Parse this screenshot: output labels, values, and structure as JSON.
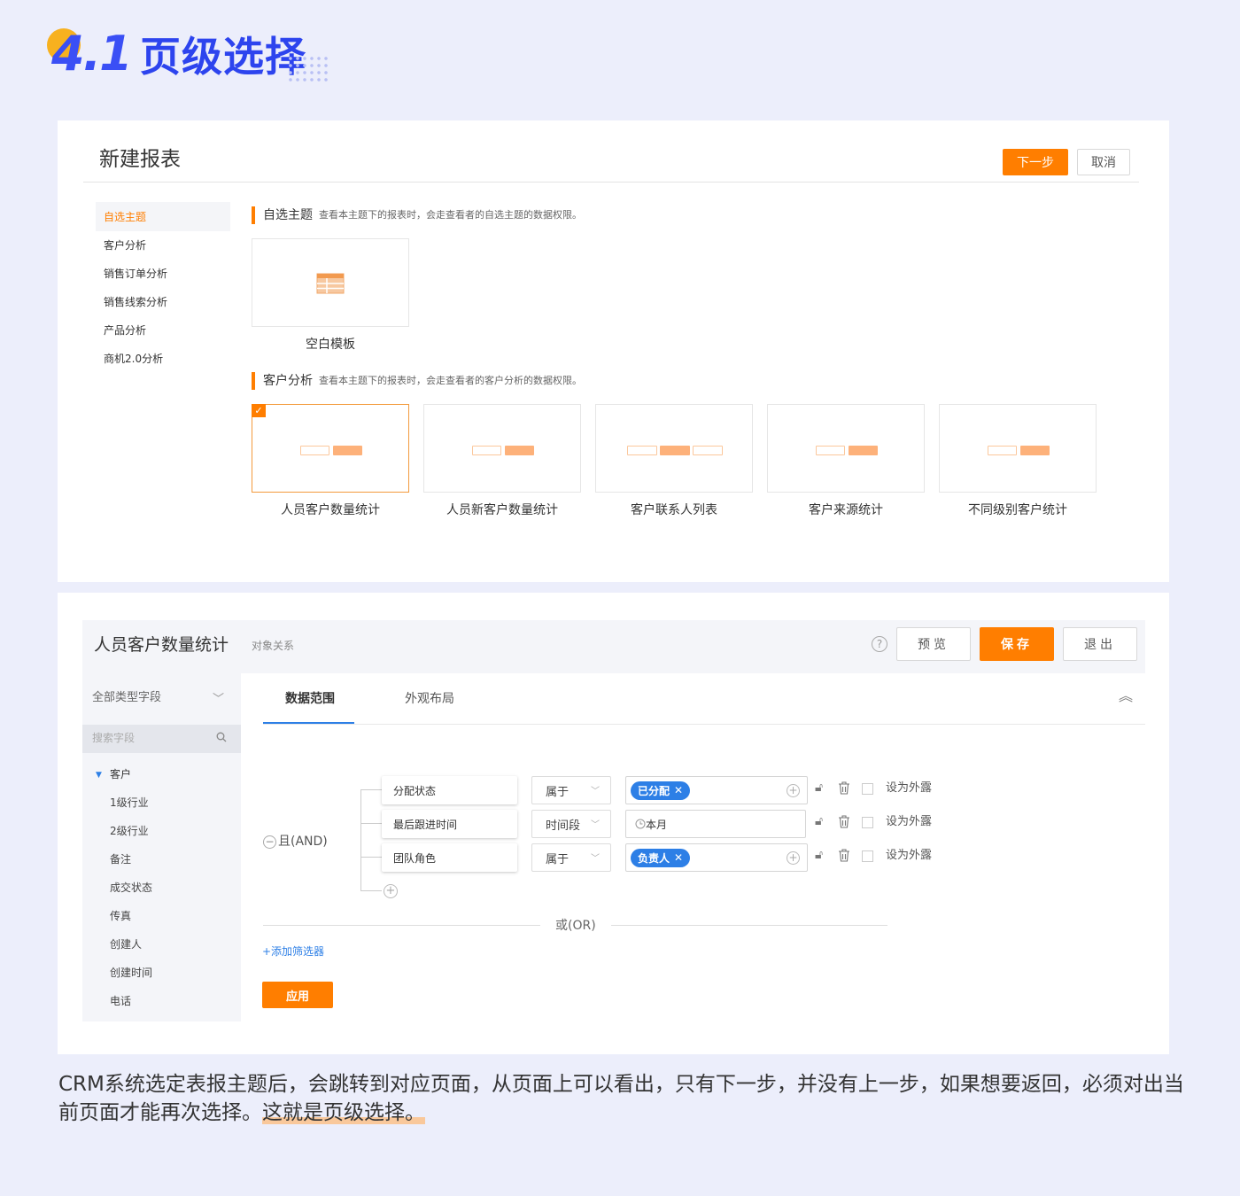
{
  "heading": {
    "number": "4.1",
    "title": "页级选择"
  },
  "panel1": {
    "title": "新建报表",
    "next_button": "下一步",
    "cancel_button": "取消",
    "sidebar": [
      "自选主题",
      "客户分析",
      "销售订单分析",
      "销售线索分析",
      "产品分析",
      "商机2.0分析"
    ],
    "sections": [
      {
        "title": "自选主题",
        "desc": "查看本主题下的报表时，会走查看者的自选主题的数据权限。",
        "cards": [
          "空白模板"
        ]
      },
      {
        "title": "客户分析",
        "desc": "查看本主题下的报表时，会走查看者的客户分析的数据权限。",
        "cards": [
          "人员客户数量统计",
          "人员新客户数量统计",
          "客户联系人列表",
          "客户来源统计",
          "不同级别客户统计"
        ]
      }
    ],
    "selected_card": "人员客户数量统计"
  },
  "panel2": {
    "title": "人员客户数量统计",
    "subtitle": "对象关系",
    "help": "?",
    "preview_button": "预览",
    "save_button": "保存",
    "exit_button": "退出",
    "left": {
      "dropdown": "全部类型字段",
      "search_placeholder": "搜索字段",
      "tree_root": "客户",
      "tree_items": [
        "1级行业",
        "2级行业",
        "备注",
        "成交状态",
        "传真",
        "创建人",
        "创建时间",
        "电话"
      ]
    },
    "tabs": [
      "数据范围",
      "外观布局"
    ],
    "active_tab": "数据范围",
    "and_label": "且(AND)",
    "filters": [
      {
        "field": "分配状态",
        "op": "属于",
        "tag": "已分配",
        "text": "",
        "extern": "设为外露"
      },
      {
        "field": "最后跟进时间",
        "op": "时间段",
        "tag": "",
        "text": "本月",
        "extern": "设为外露"
      },
      {
        "field": "团队角色",
        "op": "属于",
        "tag": "负责人",
        "text": "",
        "extern": "设为外露"
      }
    ],
    "or_label": "或(OR)",
    "add_filter": "+添加筛选器",
    "apply_button": "应用"
  },
  "caption": {
    "main": "CRM系统选定表报主题后，会跳转到对应页面，从页面上可以看出，只有下一步，并没有上一步，如果想要返回，必须对出当前页面才能再次选择。",
    "highlight": "这就是页级选择。"
  },
  "colors": {
    "accent": "#ff7e00",
    "blue": "#2d7fe6",
    "heading": "#2d44ee",
    "background": "#eceefb"
  }
}
